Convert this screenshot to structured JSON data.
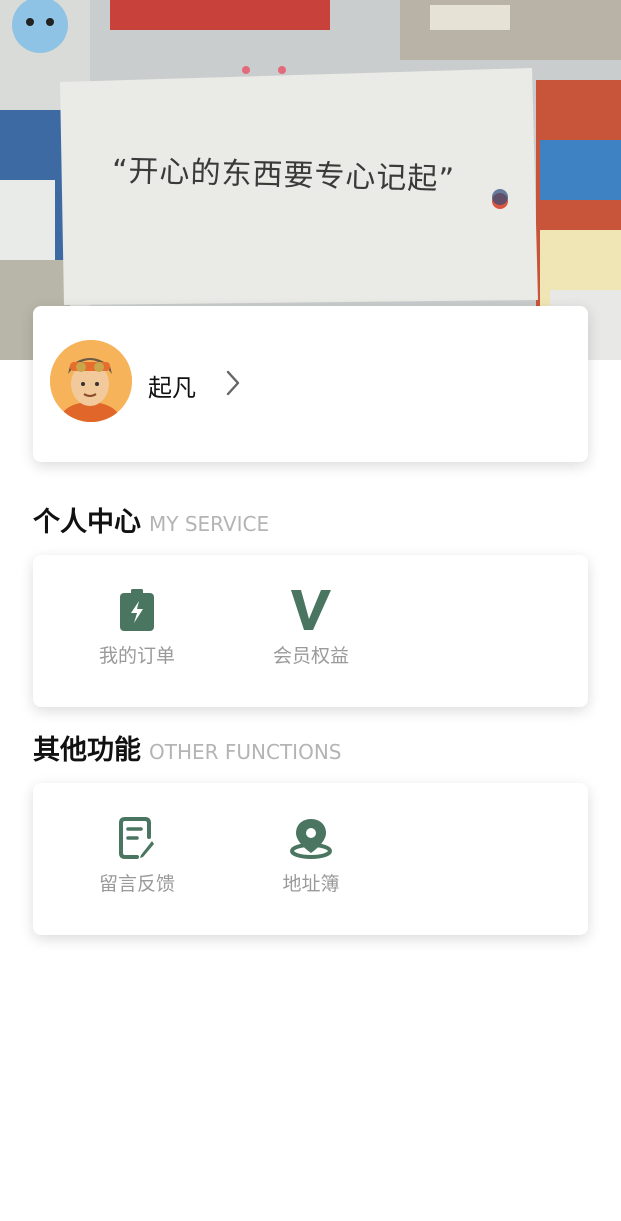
{
  "banner": {
    "quote": "“开心的东西要专心记起”"
  },
  "profile": {
    "username": "起凡"
  },
  "sections": [
    {
      "title": "个人中心",
      "subtitle": "MY SERVICE",
      "items": [
        {
          "label": "我的订单",
          "icon": "clipboard-bolt-icon"
        },
        {
          "label": "会员权益",
          "icon": "vip-v-icon"
        }
      ]
    },
    {
      "title": "其他功能",
      "subtitle": "OTHER FUNCTIONS",
      "items": [
        {
          "label": "留言反馈",
          "icon": "edit-note-icon"
        },
        {
          "label": "地址簿",
          "icon": "location-pin-icon"
        }
      ]
    }
  ],
  "colors": {
    "accent": "#4a7560",
    "label": "#9a9a9a",
    "subtitle": "#b4b4b4"
  }
}
